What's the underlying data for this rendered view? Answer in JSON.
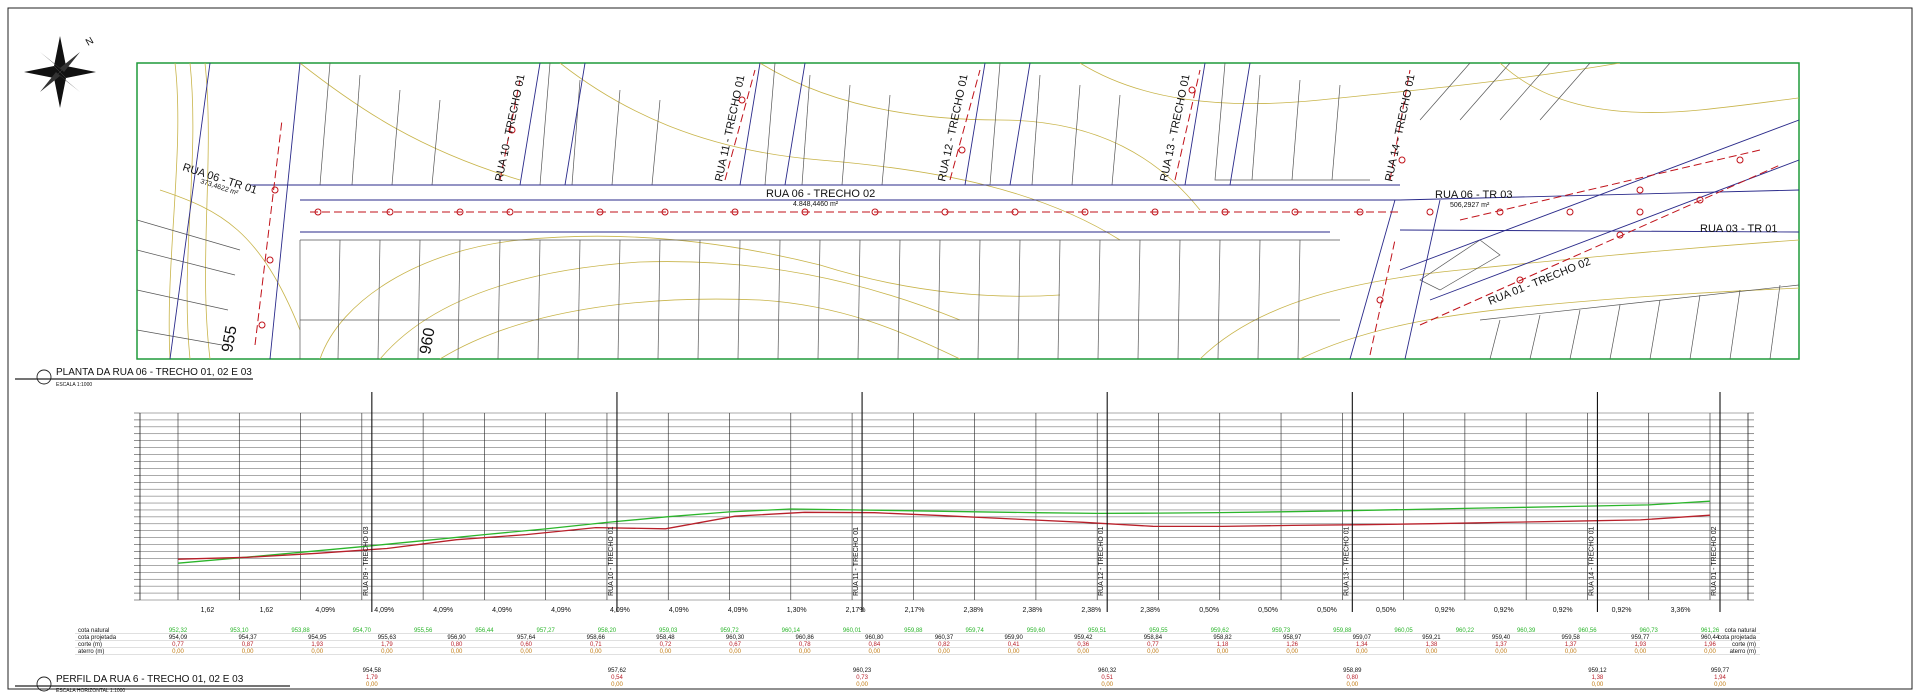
{
  "plan": {
    "title": "PLANTA DA RUA 06 - TRECHO 01, 02 E 03",
    "scale": "ESCALA 1:1000",
    "streets": [
      {
        "label": "RUA  06 - TR 01"
      },
      {
        "label": "RUA  06 - TRECHO 02"
      },
      {
        "label": "RUA  06 - TR 03"
      },
      {
        "label": "RUA  03 - TR 01"
      },
      {
        "label": "RUA  01 - TRECHO 02"
      },
      {
        "label": "RUA  10 - TRECHO 01"
      },
      {
        "label": "RUA  11 - TRECHO 01"
      },
      {
        "label": "RUA  12 - TRECHO 01"
      },
      {
        "label": "RUA  13 - TRECHO 01"
      },
      {
        "label": "RUA  14 - TRECHO 01"
      }
    ],
    "areas": [
      "373,4622 m²",
      "4.848,4460 m²",
      "506,2927 m²"
    ],
    "contours": [
      "955",
      "960"
    ]
  },
  "profile": {
    "title": "PERFIL DA RUA 6 - TRECHO 01, 02 E 03",
    "scale_h": "ESCALA HORIZONTAL 1:1000",
    "crossings": [
      "RUA 09 - TRECHO 03",
      "RUA 10 - TRECHO 01",
      "RUA 11 - TRECHO 01",
      "RUA 12 - TRECHO 01",
      "RUA 13 - TRECHO 01",
      "RUA 14 - TRECHO 01",
      "RUA 01 - TRECHO 02"
    ],
    "slopes": [
      "1,62",
      "1,62",
      "4,09%",
      "4,09%",
      "4,09%",
      "4,09%",
      "4,09%",
      "4,09%",
      "4,09%",
      "4,09%",
      "1,30%",
      "2,17%",
      "2,17%",
      "2,38%",
      "2,38%",
      "2,38%",
      "2,38%",
      "0,50%",
      "0,50%",
      "0,50%",
      "0,50%",
      "0,92%",
      "0,92%",
      "0,92%",
      "0,92%",
      "3,36%"
    ],
    "row_labels": [
      "cota natural",
      "cota projetada",
      "corte (m)",
      "aterro (m)"
    ],
    "natural": [
      "952,32",
      "953,10",
      "953,88",
      "954,70",
      "955,56",
      "956,44",
      "957,27",
      "958,20",
      "959,03",
      "959,72",
      "960,14",
      "960,01",
      "959,88",
      "959,74",
      "959,60",
      "959,51",
      "959,55",
      "959,62",
      "959,73",
      "959,88",
      "960,05",
      "960,22",
      "960,39",
      "960,56",
      "960,73",
      "961,26"
    ],
    "projected": [
      "954,09",
      "954,37",
      "954,95",
      "955,63",
      "956,90",
      "957,64",
      "958,66",
      "958,48",
      "960,30",
      "960,86",
      "960,80",
      "960,37",
      "959,90",
      "959,42",
      "958,84",
      "958,82",
      "958,97",
      "959,07",
      "959,21",
      "959,40",
      "959,58",
      "959,77",
      "960,44"
    ],
    "cut": [
      "0,77",
      "0,87",
      "1,93",
      "1,79",
      "0,80",
      "0,60",
      "0,71",
      "0,72",
      "0,67",
      "0,78",
      "0,84",
      "0,82",
      "0,41",
      "0,36",
      "0,77",
      "1,18",
      "1,26",
      "1,34",
      "1,38",
      "1,37",
      "1,37",
      "1,93",
      "1,96"
    ],
    "fill": [
      "0,00",
      "0,00",
      "0,00",
      "0,00",
      "0,00",
      "0,00",
      "0,00",
      "0,00",
      "0,00",
      "0,00",
      "0,00",
      "0,00",
      "0,00",
      "0,00",
      "0,00",
      "0,00",
      "0,00",
      "0,00",
      "0,00",
      "0,00",
      "0,00",
      "0,00",
      "0,00"
    ],
    "sub": [
      [
        "954,58",
        "1,79",
        "0,00"
      ],
      [
        "957,62",
        "0,54",
        "0,00"
      ],
      [
        "960,23",
        "0,73",
        "0,00"
      ],
      [
        "960,32",
        "0,51",
        "0,00"
      ],
      [
        "958,89",
        "0,80",
        "0,00"
      ],
      [
        "959,12",
        "1,38",
        "0,00"
      ],
      [
        "959,77",
        "1,94",
        "0,00"
      ]
    ],
    "colors": {
      "natural": "#2bb52b",
      "projected": "#b8202a",
      "grid": "#444444"
    }
  }
}
